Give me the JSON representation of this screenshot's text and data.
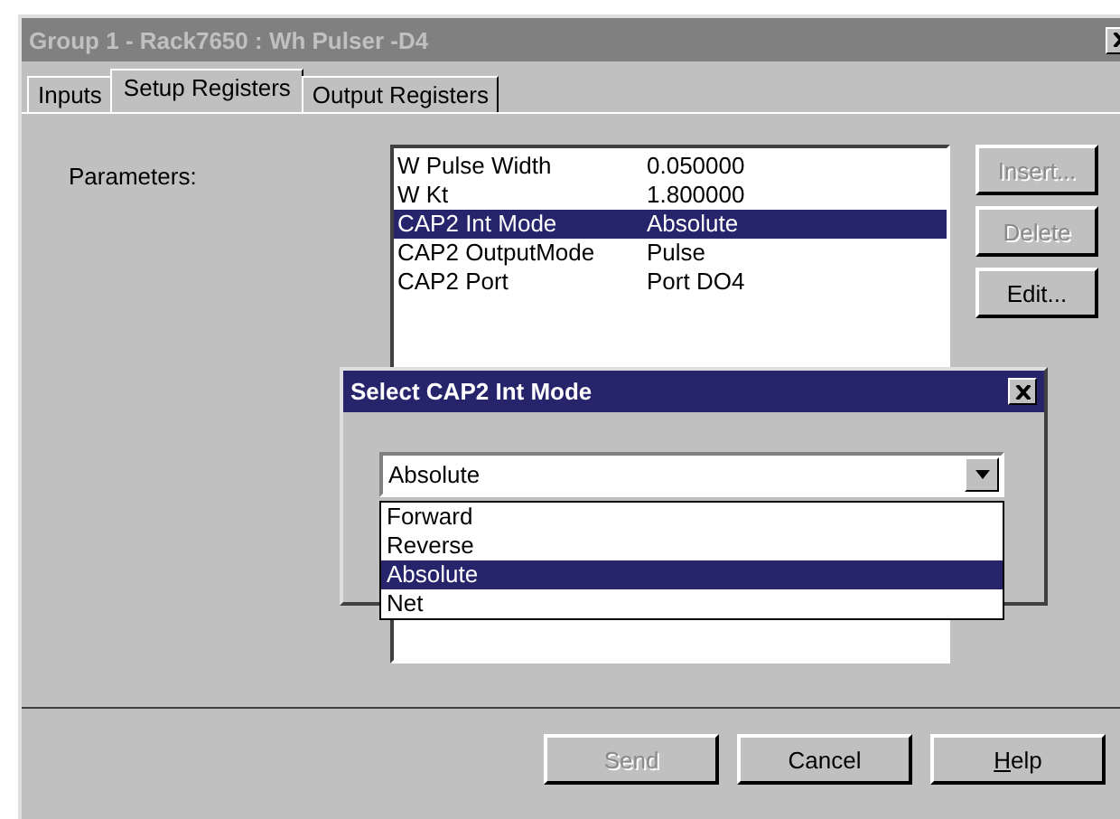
{
  "window": {
    "title": "Group 1 - Rack7650 : Wh Pulser -D4"
  },
  "tabs": [
    {
      "label": "Inputs",
      "selected": false
    },
    {
      "label": "Setup Registers",
      "selected": true
    },
    {
      "label": "Output Registers",
      "selected": false
    }
  ],
  "parameters": {
    "label": "Parameters:",
    "rows": [
      {
        "name": "W Pulse Width",
        "value": "0.050000",
        "selected": false
      },
      {
        "name": "W Kt",
        "value": "1.800000",
        "selected": false
      },
      {
        "name": "CAP2 Int Mode",
        "value": "Absolute",
        "selected": true
      },
      {
        "name": "CAP2 OutputMode",
        "value": "Pulse",
        "selected": false
      },
      {
        "name": "CAP2 Port",
        "value": "Port DO4",
        "selected": false
      }
    ]
  },
  "side_buttons": [
    {
      "label": "Insert...",
      "disabled": true
    },
    {
      "label": "Delete",
      "disabled": true
    },
    {
      "label": "Edit...",
      "disabled": false
    }
  ],
  "dialog": {
    "title": "Select CAP2 Int Mode",
    "combo": {
      "value": "Absolute"
    },
    "options": [
      {
        "label": "Forward",
        "selected": false
      },
      {
        "label": "Reverse",
        "selected": false
      },
      {
        "label": "Absolute",
        "selected": true
      },
      {
        "label": "Net",
        "selected": false
      }
    ]
  },
  "buttons": [
    {
      "label": "Send",
      "disabled": true
    },
    {
      "label": "Cancel",
      "disabled": false
    },
    {
      "label": "Help",
      "disabled": false
    }
  ]
}
